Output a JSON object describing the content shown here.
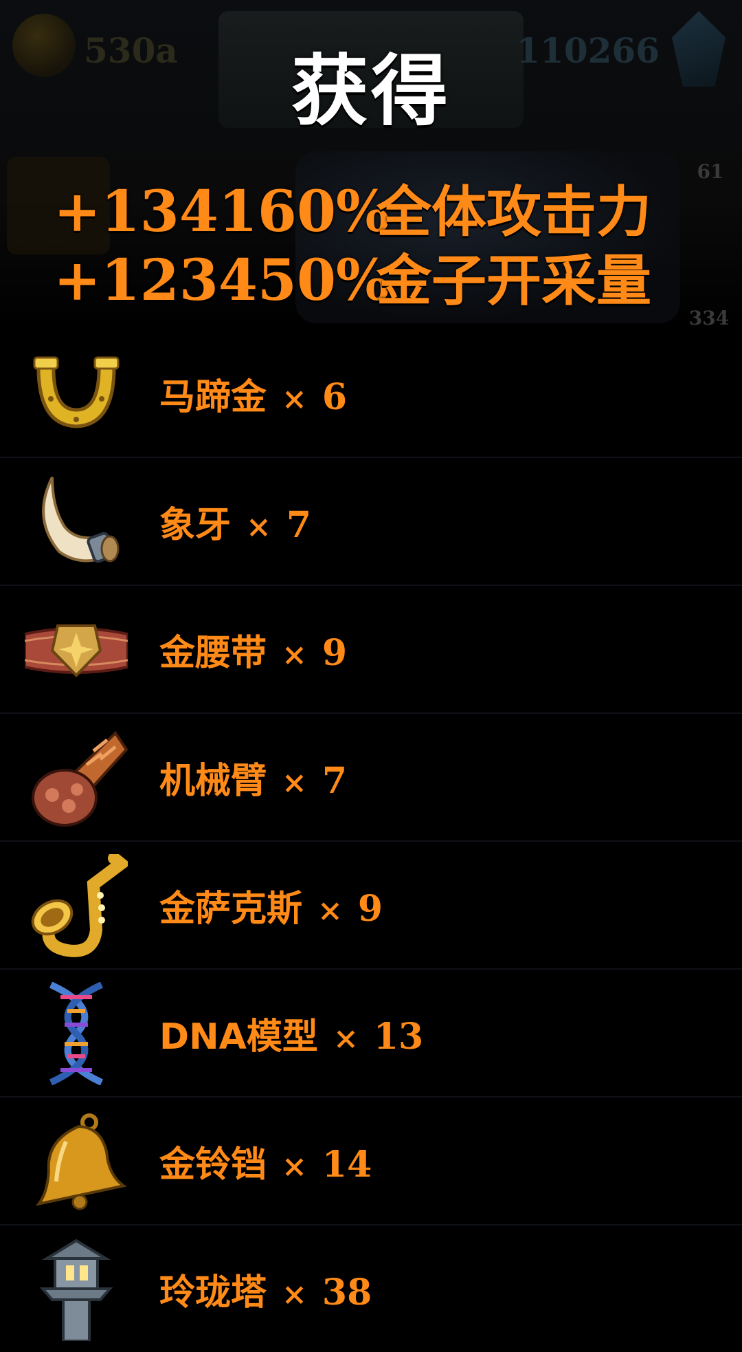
{
  "background": {
    "gold_amount": "530a",
    "gem_amount": "110266",
    "badge_top_right": "61",
    "badge_bottom_right": "334"
  },
  "title": "获得",
  "bonuses": [
    {
      "value": "+134160%",
      "stat": "全体攻击力"
    },
    {
      "value": "+123450%",
      "stat": "金子开采量"
    }
  ],
  "multiply_sign": "×",
  "items": [
    {
      "name": "马蹄金",
      "count": "6",
      "icon": "horseshoe-icon"
    },
    {
      "name": "象牙",
      "count": "7",
      "icon": "ivory-tusk-icon"
    },
    {
      "name": "金腰带",
      "count": "9",
      "icon": "gold-belt-icon"
    },
    {
      "name": "机械臂",
      "count": "7",
      "icon": "mechanical-arm-icon"
    },
    {
      "name": "金萨克斯",
      "count": "9",
      "icon": "saxophone-icon"
    },
    {
      "name": "DNA模型",
      "count": "13",
      "icon": "dna-icon"
    },
    {
      "name": "金铃铛",
      "count": "14",
      "icon": "bell-icon"
    },
    {
      "name": "玲珑塔",
      "count": "38",
      "icon": "pagoda-lantern-icon"
    }
  ],
  "colors": {
    "accent_orange": "#ff8a17",
    "title_white": "#ffffff",
    "background": "#000000"
  }
}
